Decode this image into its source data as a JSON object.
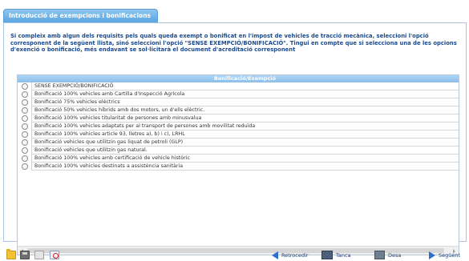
{
  "tab": {
    "title": "Introducció de exempcions i bonificacions"
  },
  "intro": {
    "text": "Si compleix amb algun dels requisits pels quals queda exempt o bonificat en l'impost de vehicles de tracció mecànica, seleccioni l'opció corresponent de la següent llista, sinó seleccioni l'opció \"SENSE EXEMPCIÓ/BONIFICACIÓ\". Tingui en compte que si selecciona una de les opcions d'exenció o bonificació, més endavant se sol·licitarà el document d'acreditació corresponent"
  },
  "grid": {
    "header": "Bonificació/Exempció",
    "rows": [
      {
        "label": "SENSE EXEMPCIÓ/BONIFICACIÓ"
      },
      {
        "label": "Bonificació 100% vehicles amb Cartilla d'Inspecció Agrícola"
      },
      {
        "label": "Bonificació 75% vehicles elèctrics"
      },
      {
        "label": "Bonificació 50% vehicles híbrids amb dos motors, un d'ells elèctric."
      },
      {
        "label": "Bonificació 100% vehicles titularitat de persones amb minusvalua"
      },
      {
        "label": "Bonificació 100% vehicles adaptats per al transport de persones amb movilitat reduïda"
      },
      {
        "label": "Bonificació 100% vehicles article 93, lletres a), b) i c), LRHL"
      },
      {
        "label": "Bonificació vehicles que utilitzin gas liquat de petroli (GLP)"
      },
      {
        "label": "Bonificació vehicles que utilitzin gas natural."
      },
      {
        "label": "Bonificació 100% vehicles amb certificació de vehicle històric"
      },
      {
        "label": "Bonificació 100% vehicles destinats a assistència sanitària"
      }
    ]
  },
  "toolbar": {
    "back_label": "Retrocedir",
    "close_label": "Tanca",
    "save_label": "Desa",
    "next_label": "Següent"
  },
  "icons": {
    "folder": "folder-icon",
    "save": "save-icon",
    "grid": "grid-icon",
    "pdf": "pdf-icon",
    "back": "arrow-left-icon",
    "close": "close-window-icon",
    "disk": "disk-icon",
    "next": "arrow-right-icon"
  },
  "colors": {
    "tab_bg": "#5aa6e2",
    "intro_text": "#1a4a8c",
    "header_bg": "#8cbfe9",
    "button_text": "#1f3d6e"
  }
}
